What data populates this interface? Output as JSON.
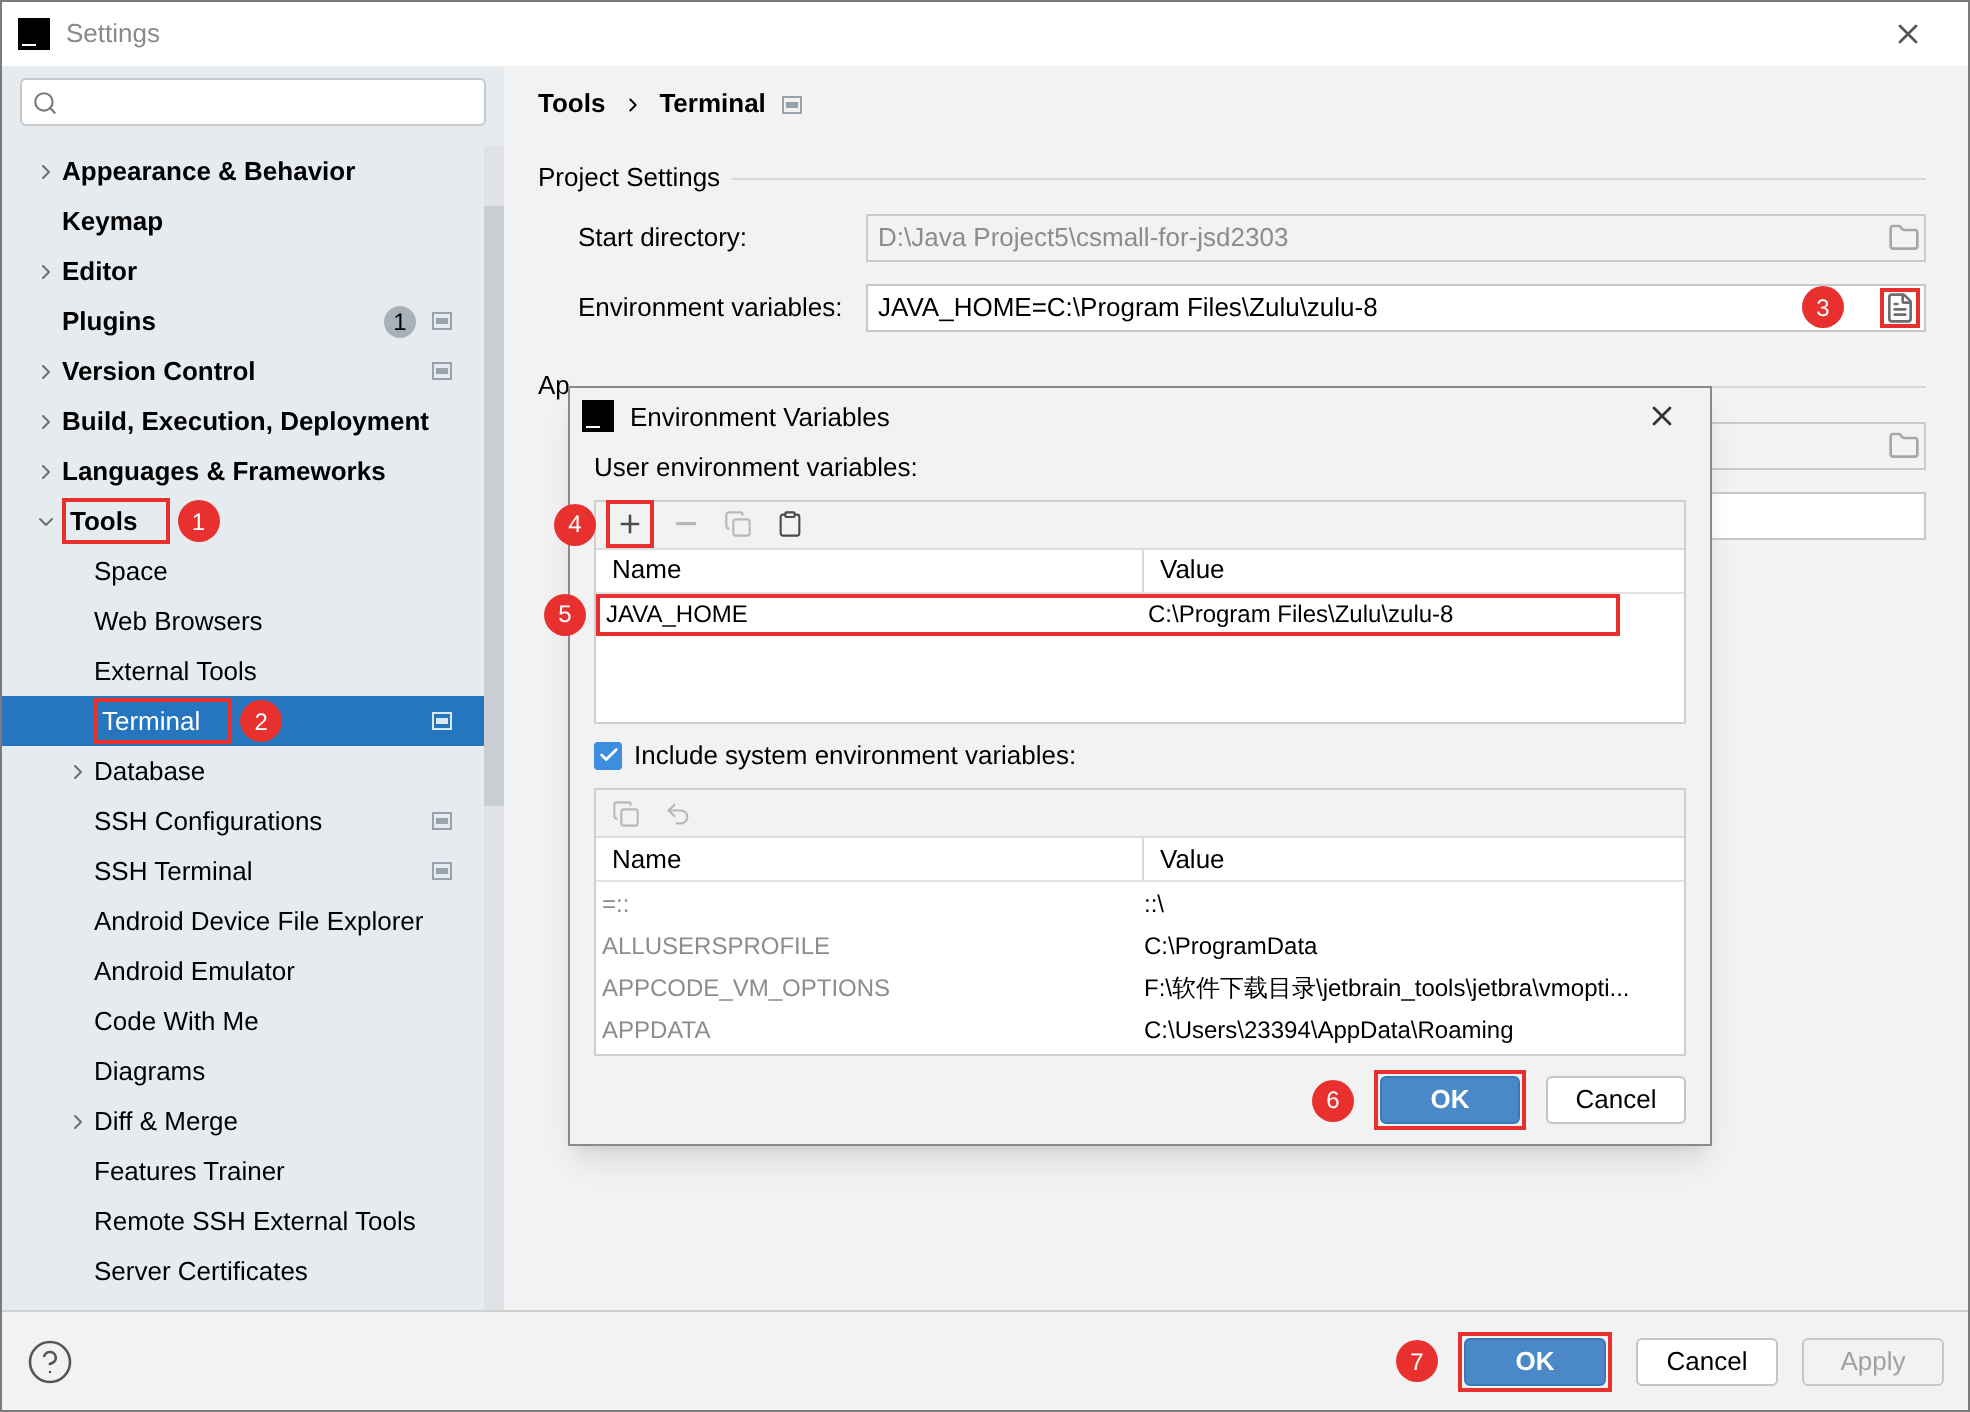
{
  "window": {
    "title": "Settings"
  },
  "sidebar": {
    "items": [
      {
        "label": "Appearance & Behavior",
        "expanded": false,
        "selected": false
      },
      {
        "label": "Keymap",
        "selected": false
      },
      {
        "label": "Editor",
        "expanded": false,
        "selected": false
      },
      {
        "label": "Plugins",
        "selected": false,
        "badge": "1",
        "project_level": true
      },
      {
        "label": "Version Control",
        "expanded": false,
        "selected": false,
        "project_level": true
      },
      {
        "label": "Build, Execution, Deployment",
        "expanded": false,
        "selected": false
      },
      {
        "label": "Languages & Frameworks",
        "expanded": false,
        "selected": false
      },
      {
        "label": "Tools",
        "expanded": true,
        "selected": false,
        "callout": "1",
        "children": [
          {
            "label": "Space",
            "selected": false
          },
          {
            "label": "Web Browsers",
            "selected": false
          },
          {
            "label": "External Tools",
            "selected": false
          },
          {
            "label": "Terminal",
            "selected": true,
            "callout": "2",
            "project_level": true
          },
          {
            "label": "Database",
            "expanded": false,
            "selected": false
          },
          {
            "label": "SSH Configurations",
            "selected": false,
            "project_level": true
          },
          {
            "label": "SSH Terminal",
            "selected": false,
            "project_level": true
          },
          {
            "label": "Android Device File Explorer",
            "selected": false
          },
          {
            "label": "Android Emulator",
            "selected": false
          },
          {
            "label": "Code With Me",
            "selected": false
          },
          {
            "label": "Diagrams",
            "selected": false
          },
          {
            "label": "Diff & Merge",
            "expanded": false,
            "selected": false
          },
          {
            "label": "Features Trainer",
            "selected": false
          },
          {
            "label": "Remote SSH External Tools",
            "selected": false
          },
          {
            "label": "Server Certificates",
            "selected": false
          }
        ]
      }
    ]
  },
  "breadcrumb": [
    "Tools",
    "Terminal"
  ],
  "project_settings": {
    "heading": "Project Settings",
    "fields": [
      {
        "label": "Start directory:",
        "value": "D:\\Java Project5\\csmall-for-jsd2303",
        "disabled": true,
        "kind": "folder"
      },
      {
        "label": "Environment variables:",
        "value": "JAVA_HOME=C:\\Program Files\\Zulu\\zulu-8",
        "disabled": false,
        "kind": "document",
        "callout": "3"
      }
    ]
  },
  "application_settings": {
    "heading": "Ap",
    "fields": [
      {
        "disabled": true,
        "kind": "folder"
      },
      {
        "disabled": false,
        "kind": "plain"
      }
    ]
  },
  "dialog": {
    "title": "Environment Variables",
    "user_label": "User environment variables:",
    "user_toolbar": [
      {
        "kind": "add",
        "disabled": false,
        "callout": "4"
      },
      {
        "kind": "remove",
        "disabled": true
      },
      {
        "kind": "copy",
        "disabled": true
      },
      {
        "kind": "paste",
        "disabled": false
      }
    ],
    "user_table": {
      "columns": [
        "Name",
        "Value"
      ],
      "rows": [
        {
          "name": "JAVA_HOME",
          "value": "C:\\Program Files\\Zulu\\zulu-8",
          "callout": "5"
        }
      ]
    },
    "include_system": {
      "label": "Include system environment variables:",
      "checked": true
    },
    "system_toolbar": [
      {
        "kind": "copy",
        "disabled": true
      },
      {
        "kind": "undo",
        "disabled": true
      }
    ],
    "system_table": {
      "columns": [
        "Name",
        "Value"
      ],
      "rows": [
        {
          "name": "=::",
          "value": "::\\"
        },
        {
          "name": "ALLUSERSPROFILE",
          "value": "C:\\ProgramData"
        },
        {
          "name": "APPCODE_VM_OPTIONS",
          "value": "F:\\软件下载目录\\jetbrain_tools\\jetbra\\vmopti..."
        },
        {
          "name": "APPDATA",
          "value": "C:\\Users\\23394\\AppData\\Roaming"
        }
      ]
    },
    "buttons": [
      {
        "label": "OK",
        "kind": "primary",
        "disabled": false,
        "callout": "6"
      },
      {
        "label": "Cancel",
        "kind": "secondary",
        "disabled": false
      }
    ]
  },
  "footer": {
    "buttons": [
      {
        "label": "OK",
        "kind": "primary",
        "disabled": false,
        "callout": "7"
      },
      {
        "label": "Cancel",
        "kind": "secondary",
        "disabled": false
      },
      {
        "label": "Apply",
        "kind": "secondary",
        "disabled": true
      }
    ]
  }
}
